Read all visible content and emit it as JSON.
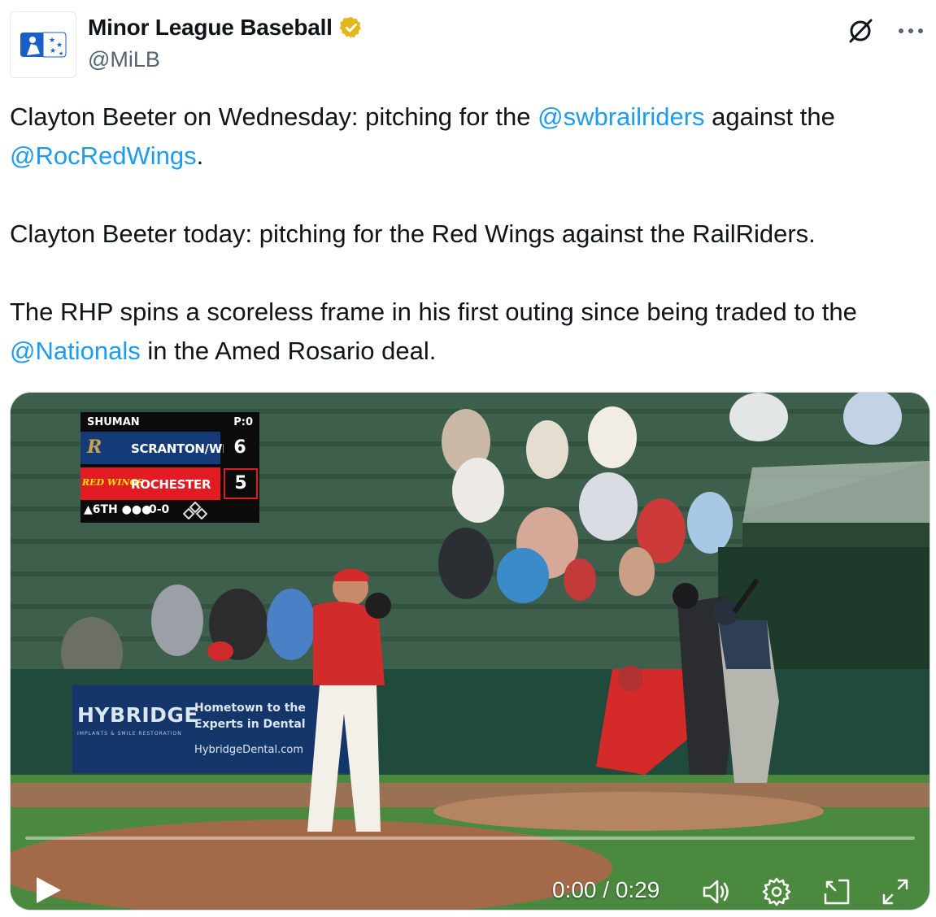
{
  "author": {
    "display_name": "Minor League Baseball",
    "handle": "@MiLB",
    "verified_badge": "gold-verified-check",
    "avatar": "milb-logo"
  },
  "actions": {
    "grok_icon": "grok-slash-circle",
    "more_icon": "more-dots"
  },
  "tweet": {
    "p1_a": "Clayton Beeter on Wednesday: pitching for the ",
    "p1_mention1": "@swbrailriders",
    "p1_b": " against the ",
    "p1_mention2": "@RocRedWings",
    "p1_c": ".",
    "p2": "Clayton Beeter today: pitching for the Red Wings against the RailRiders.",
    "p3_a": "The RHP spins a scoreless frame in his first outing since being traded to the ",
    "p3_mention": "@Nationals",
    "p3_b": " in the Amed Rosario deal."
  },
  "video": {
    "scorebug": {
      "pitcher": "SHUMAN",
      "pitch_count": "P:0",
      "team1_logo": "R",
      "team1": "SCRANTON/WB",
      "team1_score": "6",
      "team2_logo": "RED WINGS",
      "team2": "ROCHESTER",
      "team2_score": "5",
      "inning": "▲6TH ●●●",
      "count": "0-0"
    },
    "ad": {
      "brand": "HYBRIDGE",
      "tagline_sub": "IMPLANTS & SMILE RESTORATION",
      "line1": "Hometown to the",
      "line2": "Experts in Dental",
      "line3": "HybridgeDental.com"
    },
    "progress_fraction": 0.0,
    "time": "0:00 / 0:29",
    "colors": {
      "accent": "#1d9bf0",
      "gold": "#e2b719"
    }
  }
}
